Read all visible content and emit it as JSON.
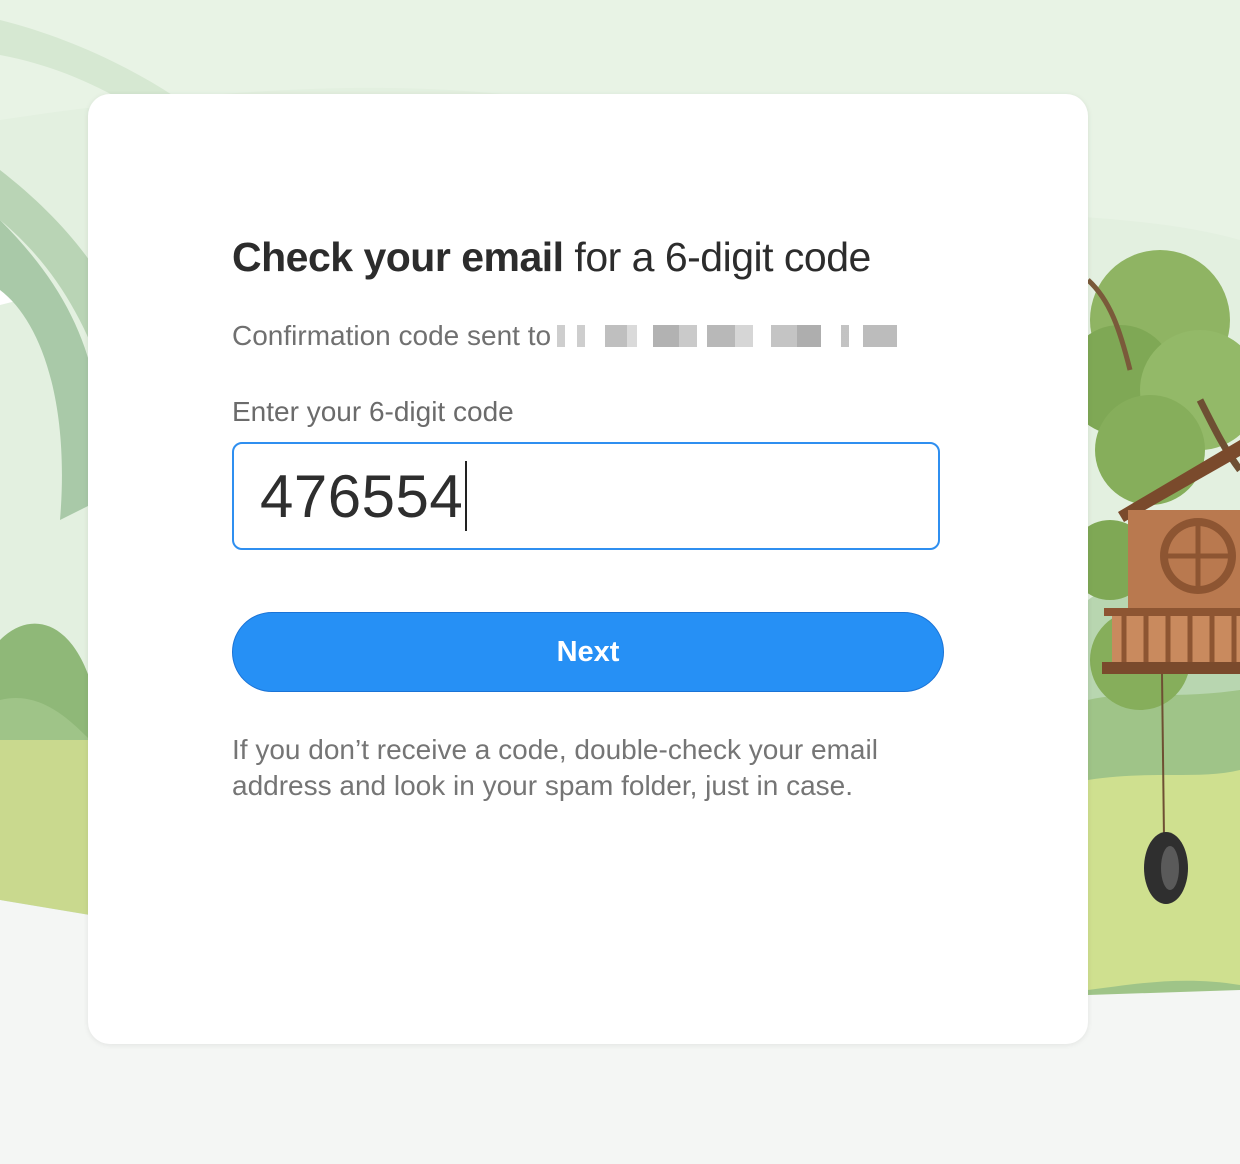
{
  "heading": {
    "strong": "Check your email",
    "rest": " for a 6-digit code"
  },
  "confirmation": {
    "prefix": "Confirmation code sent to"
  },
  "code_field": {
    "label": "Enter your 6-digit code",
    "value": "476554"
  },
  "next_button": {
    "label": "Next"
  },
  "help": {
    "text": "If you don’t receive a code, double-check your email address and look in your spam folder, just in case."
  },
  "colors": {
    "accent": "#2690f5",
    "input_border": "#2f8ff0",
    "background": "#f4f6f4"
  }
}
